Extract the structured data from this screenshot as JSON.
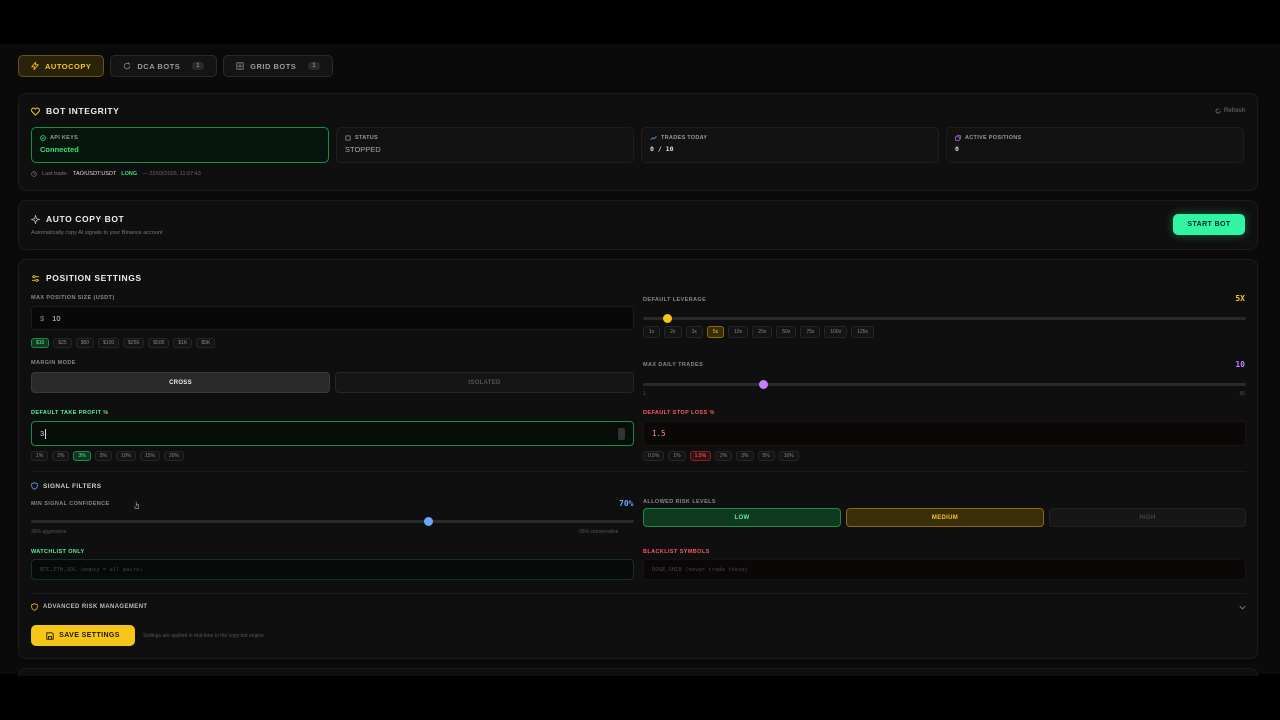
{
  "tabs": [
    {
      "label": "AUTOCOPY",
      "count": ""
    },
    {
      "label": "DCA BOTS",
      "count": "1"
    },
    {
      "label": "GRID BOTS",
      "count": "1"
    }
  ],
  "integrity": {
    "title": "BOT INTEGRITY",
    "refresh": "Refresh",
    "tiles": [
      {
        "label": "API KEYS",
        "value": "Connected"
      },
      {
        "label": "STATUS",
        "value": "STOPPED"
      },
      {
        "label": "TRADES TODAY",
        "value": "0 / 10"
      },
      {
        "label": "ACTIVE POSITIONS",
        "value": "0"
      }
    ],
    "last_trade_label": "Last trade:",
    "last_trade_pair": "TAO/USDT:USDT",
    "last_trade_side": "LONG",
    "last_trade_time": "— 22/03/2026, 11:07:43"
  },
  "autobot": {
    "title": "AUTO COPY BOT",
    "subtitle": "Automatically copy AI signals to your Binance account",
    "start": "START BOT"
  },
  "position": {
    "title": "POSITION SETTINGS",
    "max_size_label": "MAX POSITION SIZE (USDT)",
    "currency": "$",
    "max_size_value": "10",
    "size_chips": [
      "$10",
      "$25",
      "$50",
      "$100",
      "$250",
      "$500",
      "$1K",
      "$5K"
    ],
    "margin_label": "MARGIN MODE",
    "margin_options": [
      "CROSS",
      "ISOLATED"
    ],
    "tp_label": "DEFAULT TAKE PROFIT %",
    "tp_value": "3",
    "tp_chips": [
      "1%",
      "2%",
      "3%",
      "5%",
      "10%",
      "15%",
      "20%"
    ],
    "leverage_label": "DEFAULT LEVERAGE",
    "leverage_value": "5X",
    "leverage_level": 0.04,
    "leverage_chips": [
      "1x",
      "2x",
      "3x",
      "5x",
      "10x",
      "20x",
      "50x",
      "75x",
      "100x",
      "125x"
    ],
    "daily_label": "MAX DAILY TRADES",
    "daily_value": "10",
    "daily_level": 0.2,
    "daily_min": "1",
    "daily_max": "50",
    "sl_label": "DEFAULT STOP LOSS %",
    "sl_value": "1.5",
    "sl_chips": [
      "0.5%",
      "1%",
      "1.5%",
      "2%",
      "3%",
      "5%",
      "10%"
    ]
  },
  "filters": {
    "title": "SIGNAL FILTERS",
    "conf_label": "MIN SIGNAL CONFIDENCE",
    "conf_value": "70%",
    "conf_level": 0.66,
    "conf_min": "30% aggressive",
    "conf_max": "95% conservative",
    "risk_label": "ALLOWED RISK LEVELS",
    "risk_options": [
      "LOW",
      "MEDIUM",
      "HIGH"
    ],
    "watch_label": "WATCHLIST ONLY",
    "watch_placeholder": "BTC,ETH,SOL (empty = all pairs)",
    "black_label": "BLACKLIST SYMBOLS",
    "black_placeholder": "DOGE,SHIB (never trade these)"
  },
  "advanced": {
    "title": "ADVANCED RISK MANAGEMENT"
  },
  "save": {
    "label": "SAVE SETTINGS",
    "note": "Settings are applied in real-time to the copy bot engine"
  },
  "colors": {
    "accent": "#f5c518",
    "green": "#2ff5a4",
    "purple": "#c77dff",
    "blue": "#6aa8ff",
    "red": "#ff5a5a"
  }
}
